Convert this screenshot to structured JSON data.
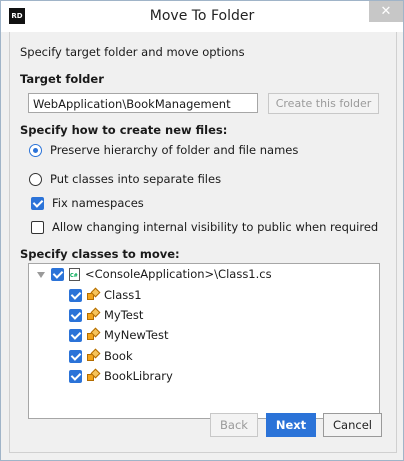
{
  "window": {
    "title": "Move To Folder",
    "app_icon_text": "RD",
    "close_glyph": "✕"
  },
  "intro": "Specify target folder and move options",
  "target": {
    "label": "Target folder",
    "value": "WebApplication\\BookManagement",
    "create_button": "Create this folder"
  },
  "files_section": {
    "label": "Specify how to create new files:",
    "options": [
      {
        "label": "Preserve hierarchy of folder and file names",
        "selected": true
      },
      {
        "label": "Put classes into separate files",
        "selected": false
      }
    ]
  },
  "checkboxes": [
    {
      "label": "Fix namespaces",
      "checked": true
    },
    {
      "label": "Allow changing internal visibility to public when required",
      "checked": false
    }
  ],
  "classes_section": {
    "label": "Specify classes to move:",
    "root": {
      "label": "<ConsoleApplication>\\Class1.cs",
      "checked": true,
      "icon": "csharp-file-icon"
    },
    "items": [
      {
        "label": "Class1",
        "checked": true,
        "icon": "class-icon"
      },
      {
        "label": "MyTest",
        "checked": true,
        "icon": "class-icon"
      },
      {
        "label": "MyNewTest",
        "checked": true,
        "icon": "class-icon"
      },
      {
        "label": "Book",
        "checked": true,
        "icon": "class-icon"
      },
      {
        "label": "BookLibrary",
        "checked": true,
        "icon": "class-icon"
      }
    ]
  },
  "buttons": {
    "back": "Back",
    "next": "Next",
    "cancel": "Cancel"
  },
  "colors": {
    "accent": "#2b73d8",
    "disabled_text": "#9a9a9a"
  }
}
